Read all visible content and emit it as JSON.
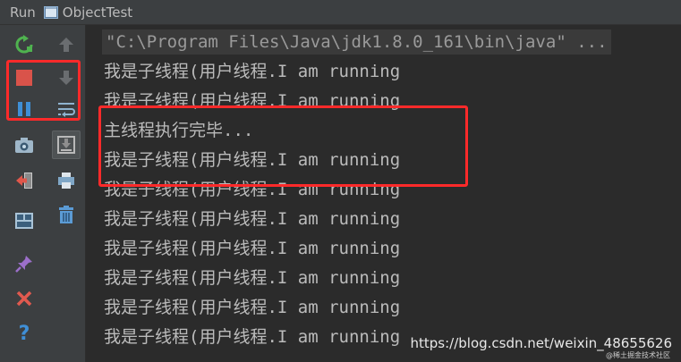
{
  "titlebar": {
    "run_label": "Run",
    "tab_title": "ObjectTest",
    "tab_icon": "console-window-icon"
  },
  "toolbar": {
    "left": [
      {
        "icon": "rerun-icon",
        "color": "#4fb34f"
      },
      {
        "icon": "stop-icon",
        "color": "#d9534a"
      },
      {
        "icon": "pause-icon",
        "color": "#3f8fd6"
      },
      {
        "icon": "camera-icon",
        "color": "#9fb7c9"
      },
      {
        "icon": "exit-icon",
        "color": "#d9534a"
      },
      {
        "icon": "layout-icon",
        "color": "#a9c3d6"
      },
      {
        "icon": "pin-icon",
        "color": "#9b6fc9"
      },
      {
        "icon": "close-icon",
        "color": "#e05a4f"
      },
      {
        "icon": "help-icon",
        "color": "#3f8fd6"
      }
    ],
    "right": [
      {
        "icon": "up-arrow-icon",
        "color": "#6a6d70"
      },
      {
        "icon": "down-arrow-icon",
        "color": "#6a6d70"
      },
      {
        "icon": "soft-wrap-icon",
        "color": "#8fb3cf"
      },
      {
        "icon": "scroll-to-end-icon",
        "color": "#b9b9b9"
      },
      {
        "icon": "print-icon",
        "color": "#7fa6c6"
      },
      {
        "icon": "trash-icon",
        "color": "#5b9bd5"
      }
    ]
  },
  "console": {
    "command": "\"C:\\Program Files\\Java\\jdk1.8.0_161\\bin\\java\" ...",
    "lines": [
      "我是子线程(用户线程.I am running",
      "我是子线程(用户线程.I am running",
      "主线程执行完毕...",
      "我是子线程(用户线程.I am running",
      "我是子线程(用户线程.I am running",
      "我是子线程(用户线程.I am running",
      "我是子线程(用户线程.I am running",
      "我是子线程(用户线程.I am running",
      "我是子线程(用户线程.I am running",
      "我是子线程(用户线程.I am running"
    ]
  },
  "colors": {
    "highlight": "#ff2a2a",
    "background": "#2b2b2b",
    "text": "#bbbbbb"
  },
  "watermark": {
    "url": "https://blog.csdn.net/weixin_48655626",
    "small": "@稀土掘金技术社区"
  }
}
